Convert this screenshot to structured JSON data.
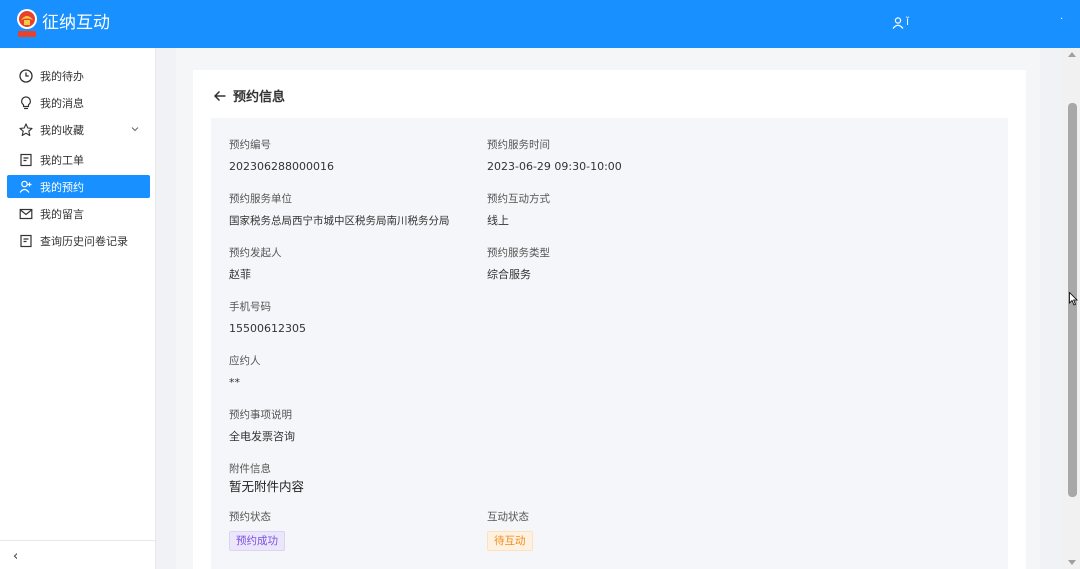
{
  "header": {
    "app_title": "征纳互动",
    "user_name": "ǐ",
    "dot": "·"
  },
  "sidebar": {
    "items": [
      {
        "label": "我的待办",
        "icon": "clock-icon"
      },
      {
        "label": "我的消息",
        "icon": "lightbulb-icon"
      },
      {
        "label": "我的收藏",
        "icon": "star-icon"
      },
      {
        "label": "我的工单",
        "icon": "document-icon"
      },
      {
        "label": "我的预约",
        "icon": "user-add-icon"
      },
      {
        "label": "我的留言",
        "icon": "mail-icon"
      },
      {
        "label": "查询历史问卷记录",
        "icon": "document-icon"
      }
    ],
    "collapse_glyph": "‹"
  },
  "page": {
    "title": "预约信息"
  },
  "details": {
    "appointment_no_label": "预约编号",
    "appointment_no": "202306288000016",
    "service_time_label": "预约服务时间",
    "service_time": "2023-06-29 09:30-10:00",
    "service_unit_label": "预约服务单位",
    "service_unit": "国家税务总局西宁市城中区税务局南川税务分局",
    "interaction_method_label": "预约互动方式",
    "interaction_method": "线上",
    "initiator_label": "预约发起人",
    "initiator": "赵菲",
    "service_type_label": "预约服务类型",
    "service_type": "综合服务",
    "phone_label": "手机号码",
    "phone": "15500612305",
    "responder_label": "应约人",
    "responder": "**",
    "description_label": "预约事项说明",
    "description": "全电发票咨询",
    "attachment_label": "附件信息",
    "attachment": "暂无附件内容",
    "status_label": "预约状态",
    "status": "预约成功",
    "interaction_status_label": "互动状态",
    "interaction_status": "待互动"
  },
  "colors": {
    "primary": "#1890ff",
    "status_success_bg": "#ece6fb",
    "status_success_text": "#7a4fe0",
    "status_pending_bg": "#fff1e0",
    "status_pending_text": "#f08c1c"
  }
}
